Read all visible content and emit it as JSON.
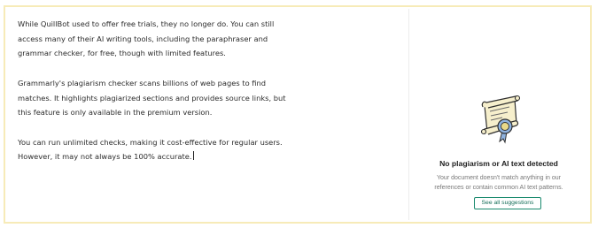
{
  "editor": {
    "paragraphs": [
      "While QuillBot used to offer free trials, they no longer do. You can still\naccess many of their AI writing tools, including the paraphraser and\ngrammar checker, for free, though with limited features.",
      "Grammarly's plagiarism checker scans billions of web pages to find\nmatches. It highlights plagiarized sections and provides source links, but\nthis feature is only available in the premium version.",
      "You can run unlimited checks, making it cost-effective for regular users.\nHowever, it may not always be 100% accurate."
    ]
  },
  "panel": {
    "illustration_icon": "scroll-with-ribbon-icon",
    "title": "No plagiarism or AI text detected",
    "description": "Your document doesn't match anything in our references or contain common AI text patterns.",
    "button_label": "See all suggestions"
  },
  "colors": {
    "frame_border": "#f7ebb8",
    "button_accent": "#1a8a6e",
    "scroll_fill": "#f6efcc",
    "ribbon_blue": "#8fb3e0"
  }
}
